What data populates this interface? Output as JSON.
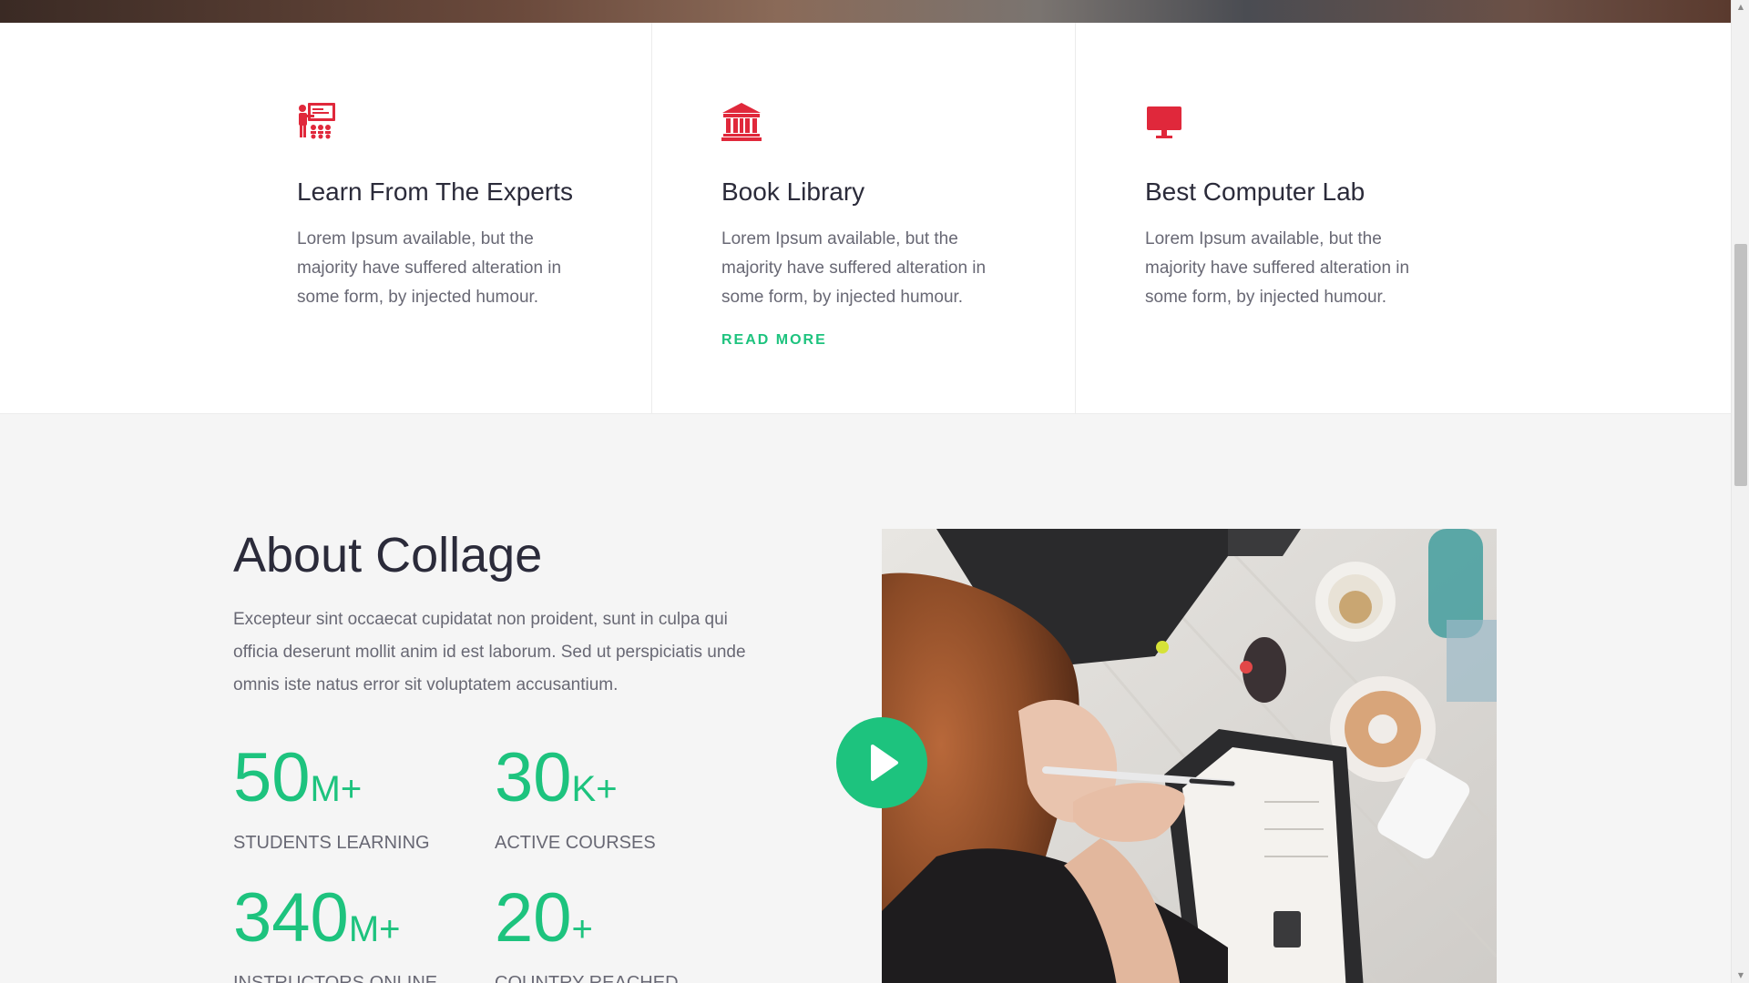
{
  "features": [
    {
      "icon": "teacher-classroom-icon",
      "title": "Learn From The Experts",
      "text": "Lorem Ipsum available, but the majority have suffered alteration in some form, by injected humour."
    },
    {
      "icon": "library-building-icon",
      "title": "Book Library",
      "text": "Lorem Ipsum available, but the majority have suffered alteration in some form, by injected humour.",
      "link": "READ MORE"
    },
    {
      "icon": "computer-monitor-icon",
      "title": "Best Computer Lab",
      "text": "Lorem Ipsum available, but the majority have suffered alteration in some form, by injected humour."
    }
  ],
  "about": {
    "title": "About Collage",
    "description": "Excepteur sint occaecat cupidatat non proident, sunt in culpa qui officia deserunt mollit anim id est laborum. Sed ut perspiciatis unde omnis iste natus error sit voluptatem accusantium.",
    "stats": [
      {
        "number": "50",
        "suffix": "M+",
        "label": "STUDENTS LEARNING"
      },
      {
        "number": "30",
        "suffix": "K+",
        "label": "ACTIVE COURSES"
      },
      {
        "number": "340",
        "suffix": "M+",
        "label": "INSTRUCTORS ONLINE"
      },
      {
        "number": "20",
        "suffix": "+",
        "label": "COUNTRY REACHED"
      }
    ],
    "video": {
      "play_icon": "play-icon",
      "image": "woman-writing-notebook-photo"
    }
  },
  "colors": {
    "accent": "#1dc37e",
    "icon": "#e0283b",
    "heading": "#2b2b3a",
    "body_text": "#686874",
    "section_bg": "#f5f5f5"
  }
}
